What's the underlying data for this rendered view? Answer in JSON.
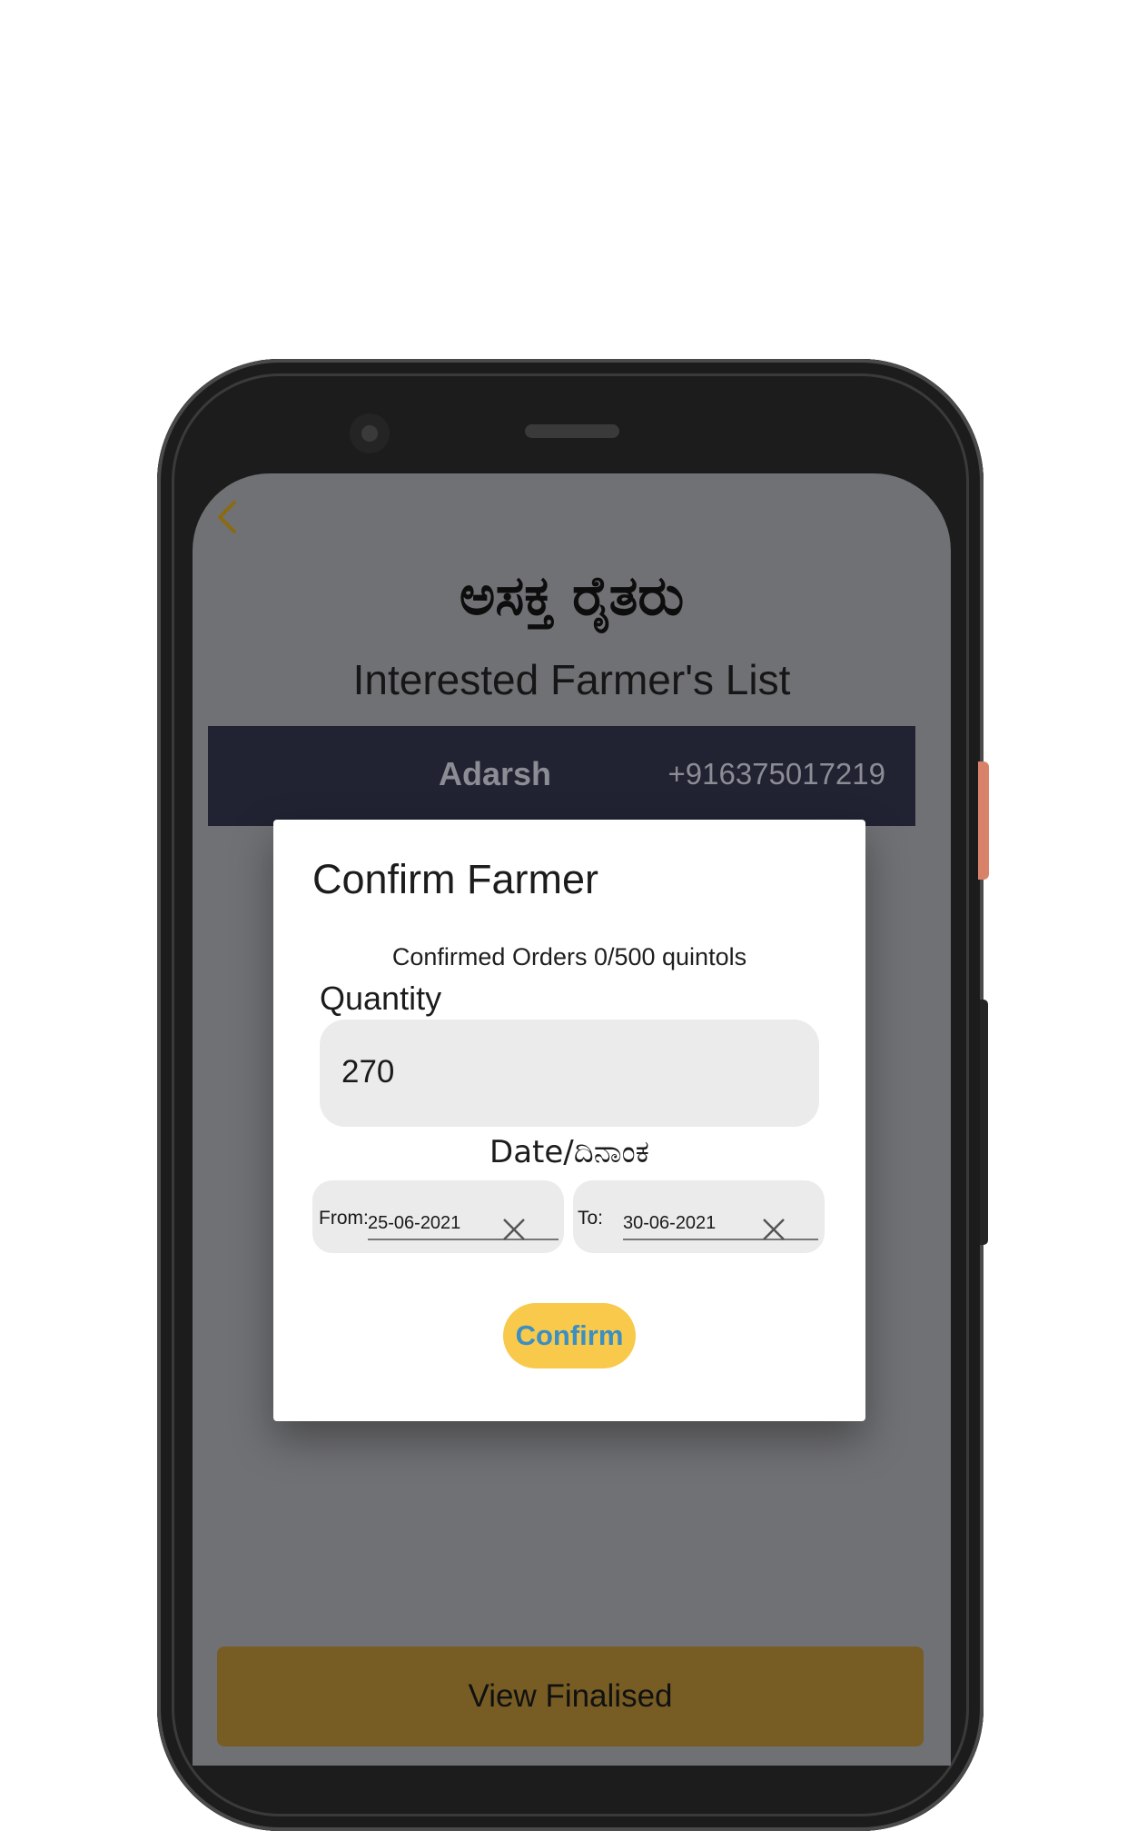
{
  "header": {
    "title_kannada": "ಅಸಕ್ತ ರೈತರು",
    "title_english": "Interested Farmer's List"
  },
  "farmer_row": {
    "name": "Adarsh",
    "phone": "+916375017219"
  },
  "dialog": {
    "title": "Confirm Farmer",
    "orders_summary": "Confirmed Orders 0/500 quintols",
    "quantity_label": "Quantity",
    "quantity_value": "270",
    "date_label": "Date/ದಿನಾಂಕ",
    "from_label": "From:",
    "from_value": "25-06-2021",
    "to_label": "To:",
    "to_value": "30-06-2021",
    "confirm_label": "Confirm"
  },
  "footer": {
    "view_finalised_label": "View Finalised"
  },
  "colors": {
    "accent_yellow": "#f8c94b",
    "confirm_text": "#3b8fc2",
    "row_background": "#212232",
    "back_icon": "#8a6a12"
  },
  "icons": [
    "back-chevron-icon",
    "clear-x-icon"
  ]
}
